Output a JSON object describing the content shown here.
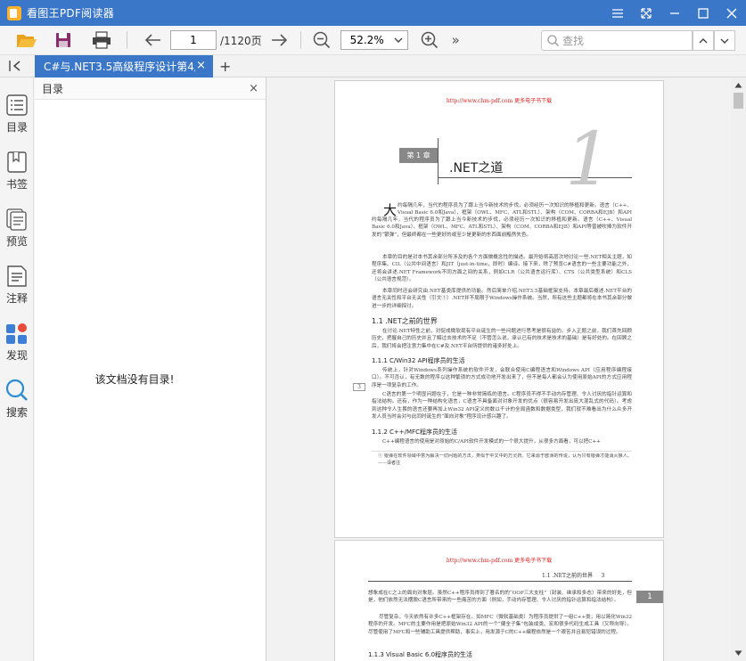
{
  "window": {
    "title": "看图王PDF阅读器",
    "controls": [
      "menu",
      "restore-small",
      "maximize",
      "minimize",
      "close"
    ]
  },
  "toolbar": {
    "page_current": "1",
    "page_total": "/1120页",
    "zoom": "52.2%",
    "more": "»",
    "search_placeholder": "查找"
  },
  "tabs": [
    {
      "label": "C#与.NET3.5高级程序设计第4版",
      "close": "×"
    }
  ],
  "tab_add": "+",
  "rail": {
    "items": [
      {
        "label": "目录"
      },
      {
        "label": "书签"
      },
      {
        "label": "预览"
      },
      {
        "label": "注释"
      },
      {
        "label": "发现"
      },
      {
        "label": "搜索"
      }
    ]
  },
  "toc": {
    "title": "目录",
    "close": "×",
    "empty_message": "该文档没有目录!"
  },
  "page1": {
    "url": "http://www.chm-pdf.com 更多电子书下载",
    "chapter_tag": "第 1 章",
    "chapter_title": ".NET之道",
    "chapter_number": "1",
    "dropcap": "大",
    "intro1": "约每隔几年，当代的程序员为了跟上当今新技术的步伐，必须经历一次知识的移植和更新。语言（C++、Visual Basic 6.0和Java）、框架（OWL、MFC、ATL和STL）、架构（COM、CORBA和EJB）和API（如.NET的Windows Forms和GDI+库）等曾被吹捧为软件开发的“银弹”①，但最终都在一些更好的或至少是更新的东西面前黯然失色。不管你在进行知识自我更新时遇到什么挫折，这都是不可避免的。本书要研究的是.NET平台和C#编程语言，这正是微软公司应当前软件开发大趋势而提供的新技术。",
    "intro2": "本章的目的是对本书其余部分所涉及的各个方面做概念性的描述。最开始将高层次地讨论一些.NET相关主题，如程序集、CIL（公共中间语言）和JIT（just-in-time，即时）编译。接下来，除了预览C#语言的一些主要功能之外，还将会讲述.NET Framework不同方面之间的关系，例如CLR（公共语言运行库）、CTS（公共类型系统）和CLS（公共语言规范）。",
    "intro3": "本章同时还会研究由.NET基类库提供的功能。然后简单介绍.NET3.5基础框架支持。本章最后概述.NET平台的语言无关性和平台无关性（引文①）.NET并不局限于Windows操作系统。当然，所有这些主题都将在本书其余部分做进一步的详细探讨。",
    "h_1_1": "1.1 .NET之前的世界",
    "p_1_1": "在讨论.NET特性之前，对促成微软现有平台诞生的一些问题进行思考是很有益的。步入正题之前，我们首先回顾历史，把握自己的历史并且了解过去技术的不足（不管怎么说，承认已有的技术是技术的基础）是有好处的。在回顾之后，我们将会把注意力集中在C#及.NET平台所提供的诸多好处上。",
    "h_1_1_1": "1.1.1 C/Win32 API程序员的生活",
    "p_1_1_1a": "传统上，针对Windows系列操作系统的软件开发，会联合使用C编程语言和Windows API（应用程序编程接口）。不可否认，有无数的程序以这种繁琐的方式成功地开发出来了，但不是每人都会认为使用原始API的方式应用程序是一项复杂的工作。",
    "p_1_1_1b": "C语言的第一个明显问题在于，它是一种非常简练的语言。C程序员不得不手动内存管理、令人讨厌的指针运算和指法结构。还有，作为一种结构化语言，C语言不具备面对对象开发的优点（很容易开发出庞大混乱式的代码）。考虑到这种令人生畏的语言还要再加上Win32 API定义的数以千计的全局函数和数据类型，我们就不难看出为什么众多开发人员当时会对与此同时诞生的“面向对象”程序设计感兴趣了。",
    "h_1_1_2": "1.1.2 C++/MFC程序员的生活",
    "p_1_1_2": "C++编程语言的使用是对原始的C/API软件开发模式的一个很大提升，从很多方面看，可以把C++",
    "footnote": "① 银弹在软件领域中意为解决一切问题的方法，类似于中文中的万灵药。它来源于欧洲的传说，认为只有银弹才能消灭狼人。——译者注",
    "margin_num": "3"
  },
  "page2": {
    "url": "http://www.chm-pdf.com 更多电子书下载",
    "header": "1.1 .NET之前的世界     3",
    "badge": "1",
    "p1": "想象成在C之上的面向对象层。虽然C++程序员得到了著名的的“OOP三大支柱”（封装、继承和多态）带来的好处，但是，他们依然无法摆脱C语言所带来的一些痛苦的方面（例如，手动内存管理、令人讨厌的指针运算和指法结构）。",
    "p2": "尽管复杂，今天依然有许多C++框架存在。如MFC（微软基础类）为程序员提供了一组C++类，用以简化Win32程序的开发。MFC的主要作用是把原始Win32 API的一个“健全子集”包装成类、宏和很多代码生成工具（又称向导）。尽管使用了MFC和一些辅助工具提供帮助，事实上，用发源于C的C++编程依然是一个艰苦并且易犯错误的过程。",
    "h_1_1_3": "1.1.3 Visual Basic 6.0程序员的生活"
  }
}
